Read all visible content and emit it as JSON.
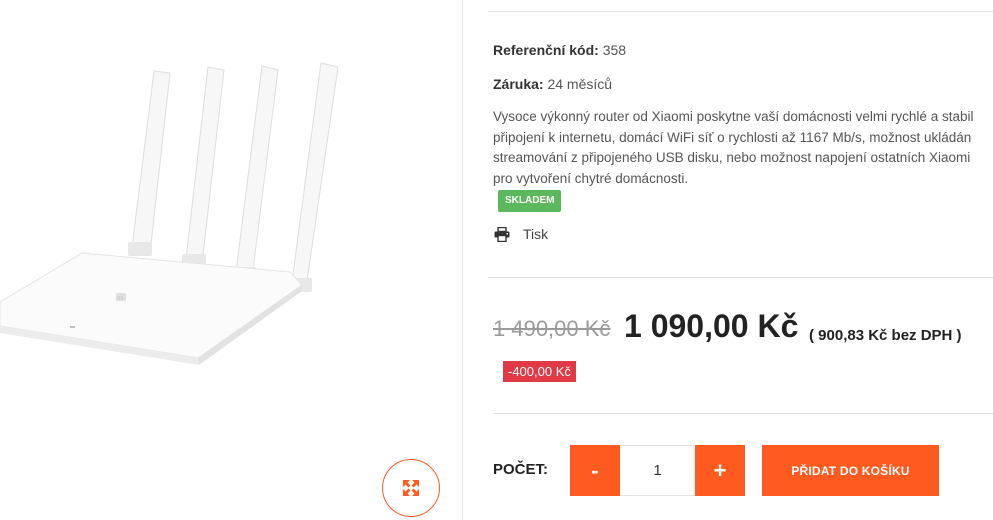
{
  "product": {
    "reference_label": "Referenční kód:",
    "reference_value": "358",
    "warranty_label": "Záruka:",
    "warranty_value": "24 měsíců",
    "description": "Vysoce výkonný router od Xiaomi poskytne vaší domácnosti velmi rychlé a stabil\npřipojení k internetu, domácí WiFi síť o rychlosti až 1167 Mb/s, možnost ukládán\nstreamování z připojeného USB disku, nebo možnost napojení ostatních Xiaomi\npro vytvoření chytré domácnosti.",
    "stock_badge": "SKLADEM",
    "print_label": "Tisk",
    "image_logo_text": "mi"
  },
  "pricing": {
    "old_price": "1 490,00 Kč",
    "new_price": "1 090,00 Kč",
    "net_price": "( 900,83 Kč bez DPH )",
    "discount": "-400,00 Kč"
  },
  "cart": {
    "quantity_label": "POČET:",
    "minus_label": "-",
    "quantity_value": "1",
    "plus_label": "+",
    "add_button_label": "PŘIDAT DO KOŠÍKU"
  },
  "colors": {
    "accent": "#ff5a1f",
    "stock_green": "#5cb85c",
    "discount_red": "#e03a47"
  },
  "icons": {
    "zoom": "expand-arrows-icon",
    "print": "printer-icon"
  }
}
